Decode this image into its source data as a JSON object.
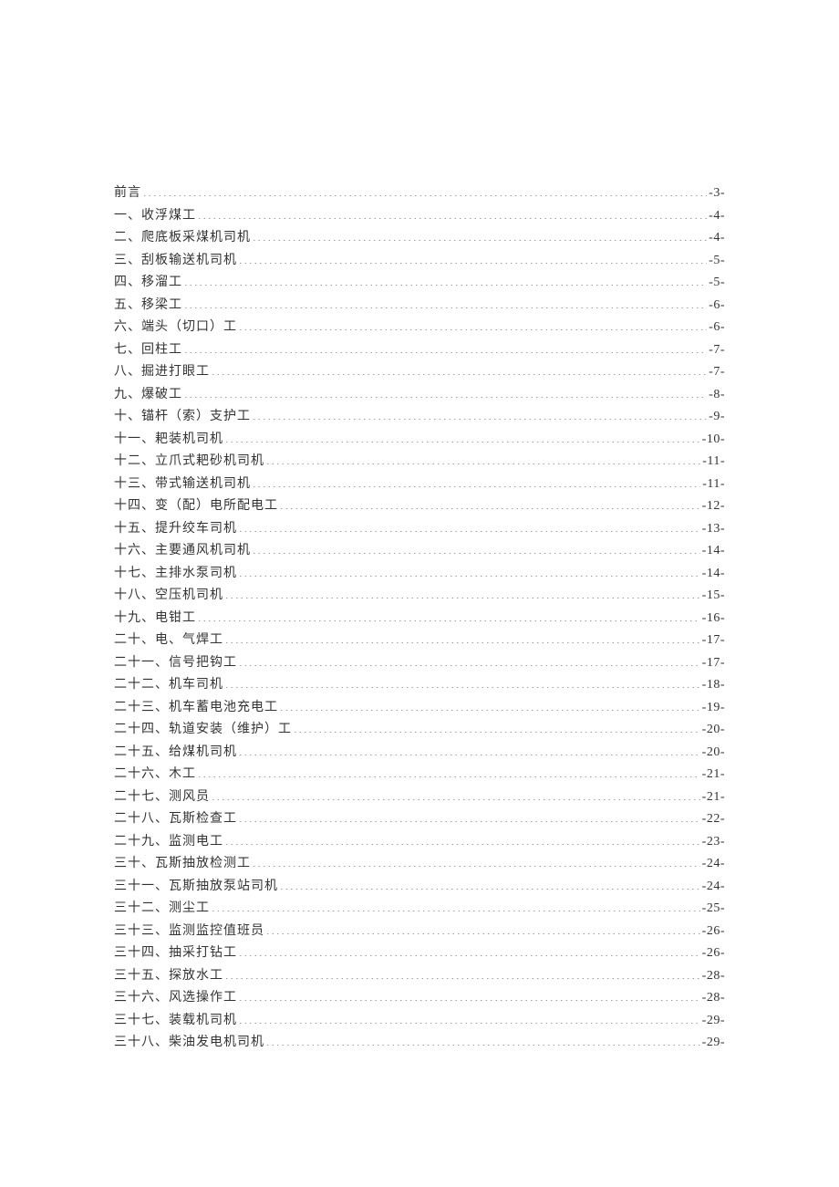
{
  "toc": [
    {
      "label": "前言",
      "page": "-3-"
    },
    {
      "label": "一、收浮煤工",
      "page": "-4-"
    },
    {
      "label": "二、爬底板采煤机司机",
      "page": "-4-"
    },
    {
      "label": "三、刮板输送机司机",
      "page": "-5-"
    },
    {
      "label": "四、移溜工",
      "page": "-5-"
    },
    {
      "label": "五、移梁工",
      "page": "-6-"
    },
    {
      "label": "六、端头（切口）工",
      "page": "-6-"
    },
    {
      "label": "七、回柱工",
      "page": "-7-"
    },
    {
      "label": "八、掘进打眼工",
      "page": "-7-"
    },
    {
      "label": "九、爆破工",
      "page": "-8-"
    },
    {
      "label": "十、锚杆（索）支护工",
      "page": "-9-"
    },
    {
      "label": "十一、耙装机司机",
      "page": "-10-"
    },
    {
      "label": "十二、立爪式耙砂机司机",
      "page": "-11-"
    },
    {
      "label": "十三、带式输送机司机",
      "page": "-11-"
    },
    {
      "label": "十四、变（配）电所配电工",
      "page": "-12-"
    },
    {
      "label": "十五、提升绞车司机",
      "page": "-13-"
    },
    {
      "label": "十六、主要通风机司机",
      "page": "-14-"
    },
    {
      "label": "十七、主排水泵司机",
      "page": "-14-"
    },
    {
      "label": "十八、空压机司机",
      "page": "-15-"
    },
    {
      "label": "十九、电钳工",
      "page": "-16-"
    },
    {
      "label": "二十、电、气焊工",
      "page": "-17-"
    },
    {
      "label": "二十一、信号把钩工",
      "page": "-17-"
    },
    {
      "label": "二十二、机车司机",
      "page": "-18-"
    },
    {
      "label": "二十三、机车蓄电池充电工",
      "page": "-19-"
    },
    {
      "label": "二十四、轨道安装（维护）工",
      "page": "-20-"
    },
    {
      "label": "二十五、给煤机司机",
      "page": "-20-"
    },
    {
      "label": "二十六、木工",
      "page": "-21-"
    },
    {
      "label": "二十七、测风员",
      "page": "-21-"
    },
    {
      "label": "二十八、瓦斯检查工",
      "page": "-22-"
    },
    {
      "label": "二十九、监测电工",
      "page": "-23-"
    },
    {
      "label": "三十、瓦斯抽放检测工",
      "page": "-24-"
    },
    {
      "label": "三十一、瓦斯抽放泵站司机",
      "page": "-24-"
    },
    {
      "label": "三十二、测尘工",
      "page": "-25-"
    },
    {
      "label": "三十三、监测监控值班员",
      "page": "-26-"
    },
    {
      "label": "三十四、抽采打钻工",
      "page": "-26-"
    },
    {
      "label": "三十五、探放水工",
      "page": "-28-"
    },
    {
      "label": "三十六、风选操作工",
      "page": "-28-"
    },
    {
      "label": "三十七、装载机司机",
      "page": "-29-"
    },
    {
      "label": "三十八、柴油发电机司机",
      "page": "-29-"
    }
  ]
}
